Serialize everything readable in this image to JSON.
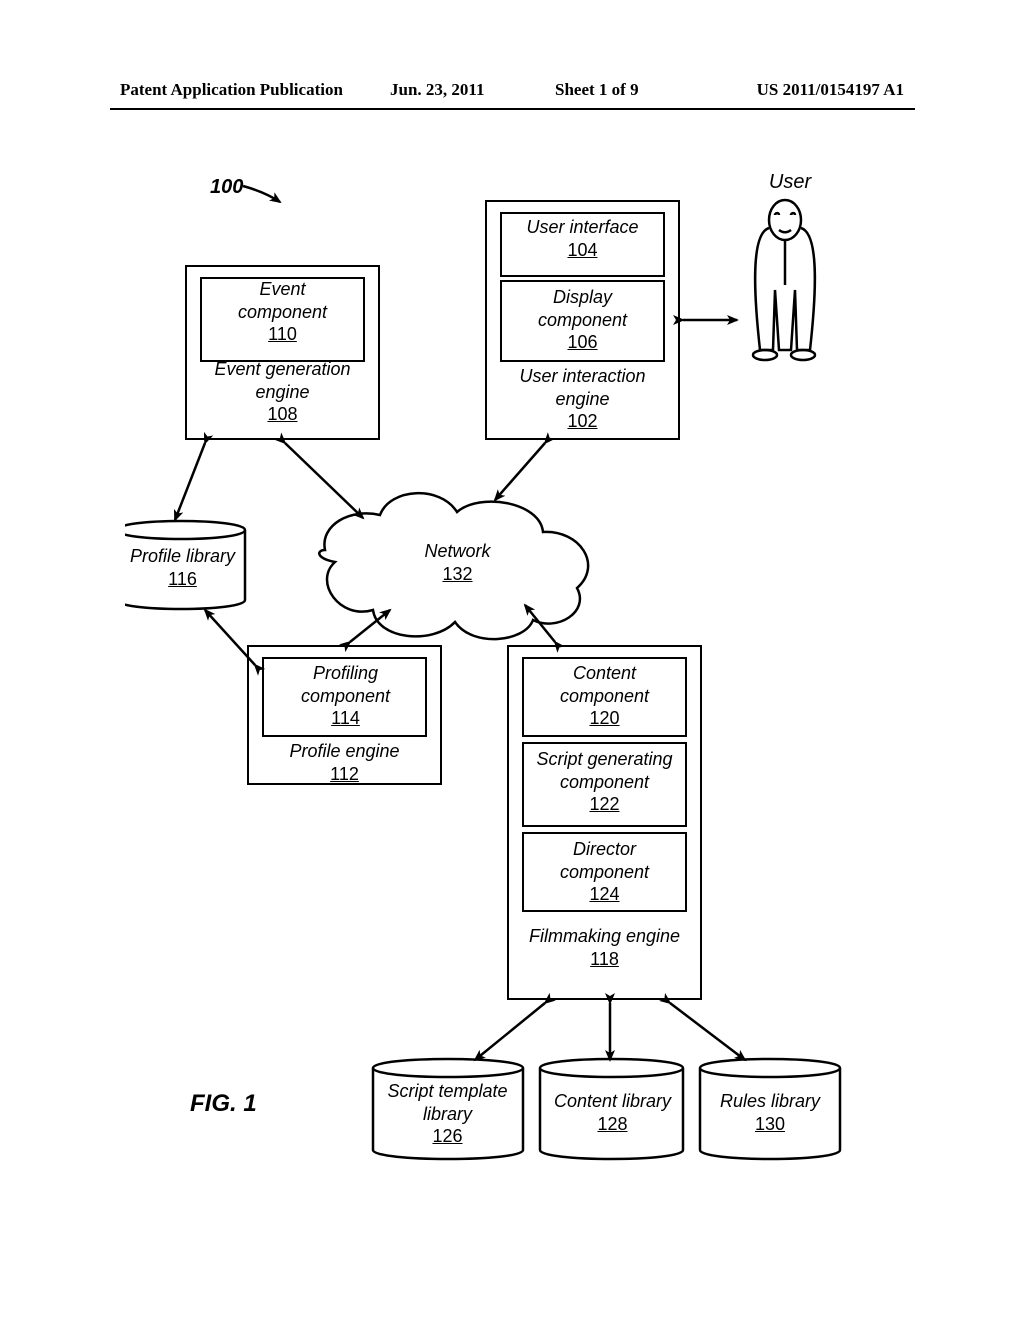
{
  "header": {
    "left": "Patent Application Publication",
    "date": "Jun. 23, 2011",
    "sheet": "Sheet 1 of 9",
    "pubnum": "US 2011/0154197 A1"
  },
  "figure_number_label": "100",
  "figure_label": "FIG. 1",
  "user_label": "User",
  "engines": {
    "event_gen": {
      "name": "Event generation\nengine",
      "ref": "108"
    },
    "user_interaction": {
      "name": "User interaction\nengine",
      "ref": "102"
    },
    "profile": {
      "name": "Profile engine",
      "ref": "112"
    },
    "filmmaking": {
      "name": "Filmmaking engine",
      "ref": "118"
    }
  },
  "components": {
    "event": {
      "name": "Event\ncomponent",
      "ref": "110"
    },
    "user_interface": {
      "name": "User interface",
      "ref": "104"
    },
    "display": {
      "name": "Display\ncomponent",
      "ref": "106"
    },
    "profiling": {
      "name": "Profiling\ncomponent",
      "ref": "114"
    },
    "content": {
      "name": "Content\ncomponent",
      "ref": "120"
    },
    "script_gen": {
      "name": "Script generating\ncomponent",
      "ref": "122"
    },
    "director": {
      "name": "Director\ncomponent",
      "ref": "124"
    }
  },
  "datastores": {
    "profile_library": {
      "name": "Profile library",
      "ref": "116"
    },
    "script_template_library": {
      "name": "Script template\nlibrary",
      "ref": "126"
    },
    "content_library": {
      "name": "Content library",
      "ref": "128"
    },
    "rules_library": {
      "name": "Rules library",
      "ref": "130"
    }
  },
  "network": {
    "name": "Network",
    "ref": "132"
  }
}
